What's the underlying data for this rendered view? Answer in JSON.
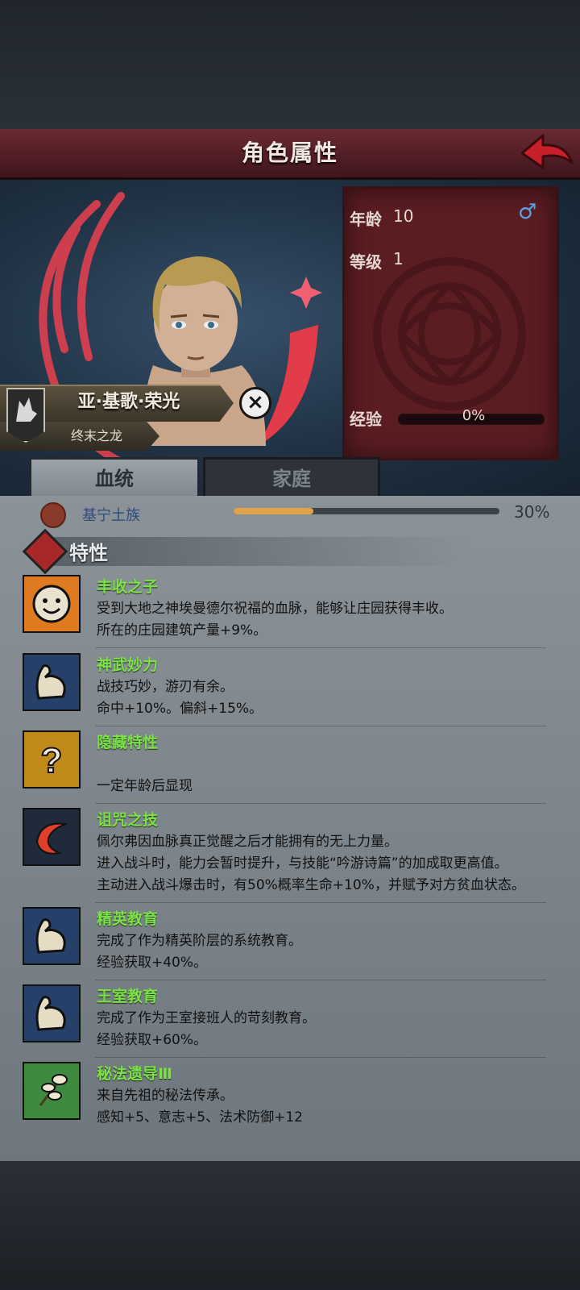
{
  "header": {
    "title": "角色属性"
  },
  "character": {
    "name": "亚·基歌·荣光",
    "epithet": "终末之龙",
    "age_label": "年龄",
    "age": "10",
    "level_label": "等级",
    "level": "1",
    "gender": "♂",
    "exp_label": "经验",
    "exp_value": "0%",
    "exp_fraction": 0
  },
  "tabs": [
    {
      "label": "血统",
      "active": true
    },
    {
      "label": "家庭",
      "active": false
    }
  ],
  "bloodline": {
    "name": "基宁土族",
    "value": "30%",
    "fraction": 0.3
  },
  "traits_header": "特性",
  "traits": [
    {
      "icon": "smiley-icon",
      "name": "丰收之子",
      "lines": [
        "受到大地之神埃曼德尔祝福的血脉，能够让庄园获得丰收。",
        "所在的庄园建筑产量+9%。"
      ]
    },
    {
      "icon": "muscle-arm-icon",
      "name": "神武妙力",
      "lines": [
        "战技巧妙，游刃有余。",
        "命中+10%。偏斜+15%。"
      ]
    },
    {
      "icon": "question-mark-icon",
      "name": "隐藏特性",
      "lines": [
        "",
        "一定年龄后显现"
      ]
    },
    {
      "icon": "crimson-wave-icon",
      "name": "诅咒之技",
      "lines": [
        "佩尔弗因血脉真正觉醒之后才能拥有的无上力量。",
        "进入战斗时，能力会暂时提升，与技能“吟游诗篇”的加成取更高值。",
        "主动进入战斗爆击时，有50%概率生命+10%，并赋予对方贫血状态。"
      ]
    },
    {
      "icon": "muscle-arm-icon",
      "name": "精英教育",
      "lines": [
        "完成了作为精英阶层的系统教育。",
        "经验获取+40%。"
      ]
    },
    {
      "icon": "muscle-arm-icon",
      "name": "王室教育",
      "lines": [
        "完成了作为王室接班人的苛刻教育。",
        "经验获取+60%。"
      ]
    },
    {
      "icon": "herb-sprig-icon",
      "name": "秘法遗导Ⅲ",
      "lines": [
        "来自先祖的秘法传承。",
        "感知+5、意志+5、法术防御+12"
      ]
    }
  ],
  "colors": {
    "title_bar": "#5a1f26",
    "trait_name": "#7de04a",
    "bloodline_name": "#2e4b7a",
    "progress_fill": "#e0a24a"
  }
}
